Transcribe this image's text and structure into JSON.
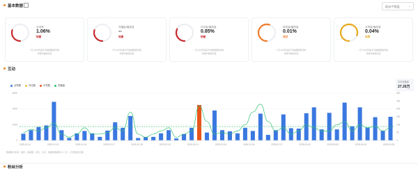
{
  "basic": {
    "title": "基本数据",
    "period_select": "近30个作品",
    "kpis": [
      {
        "name": "互动率",
        "value": "1.06%",
        "level": "较差",
        "color": "#c8282d",
        "ratio": 0.3,
        "note1": "T日-30日作品平均数据相较同类",
        "note2": "作者中等级标签"
      },
      {
        "name": "完播量/播放量",
        "value": "--",
        "level": "较差",
        "color": "#c8282d",
        "ratio": 0.3,
        "note1": "T日-30日作品平均数据相较同类",
        "note2": "作者中等级标签"
      },
      {
        "name": "评论量/播放量",
        "value": "0.85%",
        "level": "较差",
        "color": "#c8282d",
        "ratio": 0.32,
        "note1": "T日-30日作品平均数据相较同类",
        "note2": "作者中等级标签"
      },
      {
        "name": "转发量/播放量",
        "value": "0.01%",
        "level": "良好",
        "color": "#f07a28",
        "ratio": 0.55,
        "note1": "T日-30日作品平均数据相较同类",
        "note2": "作者中等级标签"
      },
      {
        "name": "点赞量/播放量",
        "value": "0.04%",
        "level": "优秀",
        "color": "#e8a81a",
        "ratio": 0.8,
        "note1": "T日-30日作品平均数据相较同类",
        "note2": "作者中等级标签"
      }
    ]
  },
  "interaction": {
    "title": "互动",
    "legend": [
      {
        "label": "点赞数",
        "color": "#3a78e0"
      },
      {
        "label": "评论数",
        "color": "#f2c14e"
      },
      {
        "label": "分享数",
        "color": "#e8561b"
      },
      {
        "label": "完播量",
        "color": "#2fbf71"
      }
    ],
    "avg_label": "平均完播量",
    "avg_value": "27.26万",
    "footnote": "数据统计区间：发布、完播量、评论、分享、收藏的数据均以 T 日 - 1 天至结束日期",
    "next_section": "粉丝分析"
  },
  "chart_data": {
    "type": "bar",
    "x": [
      "2025-02-11",
      "",
      "2025-02-13",
      "",
      "2025-02-15",
      "",
      "2025-02-17",
      "",
      "2025-02-19",
      "",
      "2025-02-19",
      "",
      "2025-02-21",
      "",
      "2025-02-24",
      "",
      "2025-02-25",
      "",
      "2025-02-25",
      "",
      "2025-02-27",
      "",
      "2025-03-01",
      "",
      "2025-03-02",
      "",
      "2025-03-03",
      "",
      "2025-03-04",
      "",
      "2025-03-06",
      ""
    ],
    "x_tick_labels": [
      "2025-02-11",
      "2025-02-13",
      "2025-02-15",
      "2025-02-17",
      "2025-02-18",
      "2025-02-19",
      "2025-02-21",
      "2025-02-24",
      "2025-02-25",
      "2025-02-27",
      "2025-03-02",
      "2025-03-03",
      "2025-03-04",
      "2025-03-06"
    ],
    "y_left_ticks": [
      "6000",
      "4000",
      "2000",
      "0"
    ],
    "y_left_max": 6000,
    "y_right_ticks": [
      "300",
      "250",
      "200",
      "150",
      "100",
      "50",
      "0"
    ],
    "y_right_max": 300,
    "series": [
      {
        "name": "点赞数",
        "values": [
          850,
          1300,
          1700,
          1900,
          4900,
          1300,
          300,
          900,
          1200,
          900,
          450,
          1250,
          2300,
          1600,
          3100,
          300,
          400,
          450,
          900,
          1300,
          250,
          800,
          1600,
          700,
          1000,
          3800,
          1300,
          1150,
          900,
          1600,
          1200,
          3400,
          700,
          1300,
          3300,
          1550,
          1500,
          3450,
          4200,
          1400,
          3500,
          1400,
          4800,
          1800,
          4200,
          1650,
          2950,
          1200,
          3000
        ]
      },
      {
        "name": "评论数",
        "values": []
      },
      {
        "name": "分享数",
        "values": [
          0,
          0,
          0,
          0,
          0,
          0,
          0,
          0,
          0,
          0,
          0,
          0,
          0,
          0,
          0,
          0,
          0,
          0,
          0,
          0,
          0,
          0,
          0,
          4500,
          0,
          0,
          0,
          0,
          0,
          0,
          0,
          0,
          0,
          0,
          0,
          0,
          0,
          0,
          0,
          0,
          0,
          0,
          0,
          0,
          0,
          0,
          0,
          0,
          0
        ]
      },
      {
        "name": "完播量",
        "values": [
          50,
          70,
          60,
          80,
          110,
          40,
          20,
          40,
          80,
          40,
          40,
          50,
          80,
          60,
          180,
          40,
          20,
          40,
          60,
          80,
          20,
          40,
          60,
          220,
          120,
          40,
          50,
          40,
          60,
          100,
          180,
          230,
          120,
          60,
          80,
          40,
          60,
          100,
          80,
          60,
          60,
          100,
          120,
          60,
          100,
          80,
          90,
          60,
          80
        ]
      }
    ]
  }
}
